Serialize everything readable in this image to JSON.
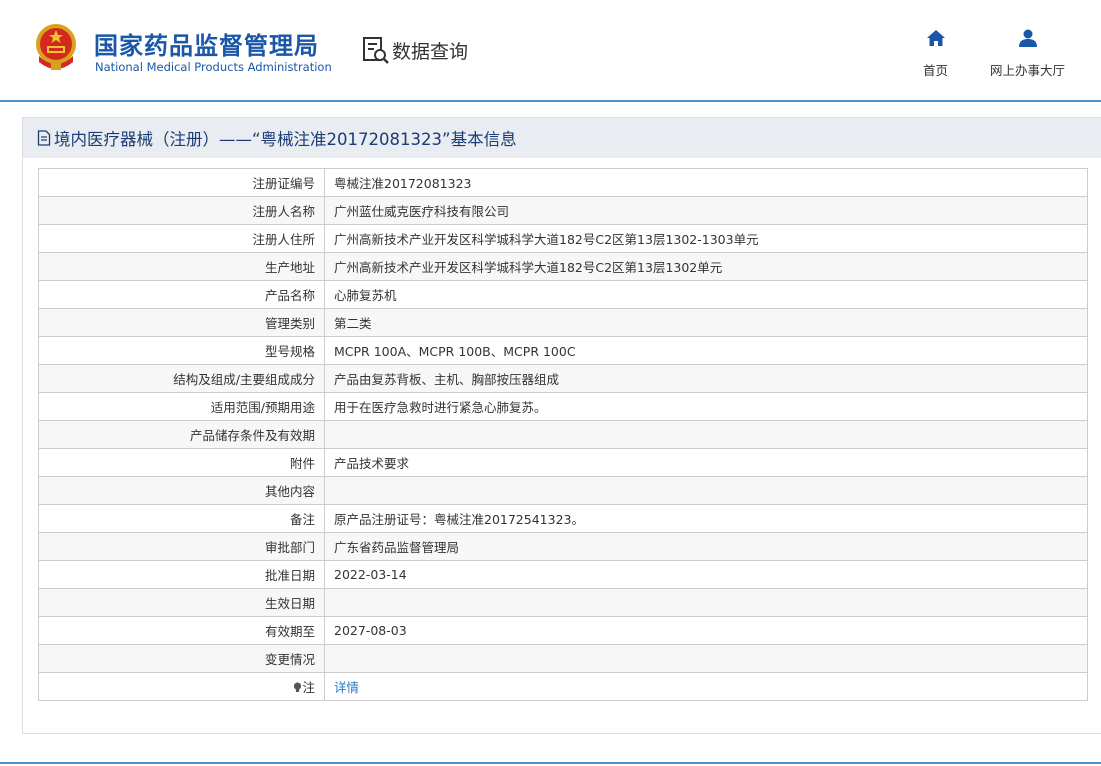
{
  "header": {
    "agency_cn": "国家药品监督管理局",
    "agency_en": "National Medical Products Administration",
    "section": "数据查询",
    "nav": [
      {
        "label": "首页",
        "icon": "home-icon"
      },
      {
        "label": "网上办事大厅",
        "icon": "user-icon"
      }
    ]
  },
  "panel": {
    "title": "境内医疗器械（注册）——“粤械注准20172081323”基本信息",
    "rows": [
      {
        "key": "注册证编号",
        "value": "粤械注准20172081323"
      },
      {
        "key": "注册人名称",
        "value": "广州蓝仕威克医疗科技有限公司"
      },
      {
        "key": "注册人住所",
        "value": "广州高新技术产业开发区科学城科学大道182号C2区第13层1302-1303单元"
      },
      {
        "key": "生产地址",
        "value": "广州高新技术产业开发区科学城科学大道182号C2区第13层1302单元"
      },
      {
        "key": "产品名称",
        "value": "心肺复苏机"
      },
      {
        "key": "管理类别",
        "value": "第二类"
      },
      {
        "key": "型号规格",
        "value": "MCPR 100A、MCPR 100B、MCPR 100C"
      },
      {
        "key": "结构及组成/主要组成成分",
        "value": "产品由复苏背板、主机、胸部按压器组成"
      },
      {
        "key": "适用范围/预期用途",
        "value": "用于在医疗急救时进行紧急心肺复苏。"
      },
      {
        "key": "产品储存条件及有效期",
        "value": ""
      },
      {
        "key": "附件",
        "value": "产品技术要求"
      },
      {
        "key": "其他内容",
        "value": ""
      },
      {
        "key": "备注",
        "value": "原产品注册证号：粤械注准20172541323。"
      },
      {
        "key": "审批部门",
        "value": "广东省药品监督管理局"
      },
      {
        "key": "批准日期",
        "value": "2022-03-14"
      },
      {
        "key": "生效日期",
        "value": ""
      },
      {
        "key": "有效期至",
        "value": "2027-08-03"
      },
      {
        "key": "变更情况",
        "value": ""
      }
    ],
    "note": {
      "key": "注",
      "link": "详情",
      "icon": "bulb-icon"
    }
  },
  "colors": {
    "brand": "#1a57a7",
    "accent_line": "#4a8fd0",
    "link": "#2b78c5",
    "title_bg": "#e9ecf0"
  }
}
